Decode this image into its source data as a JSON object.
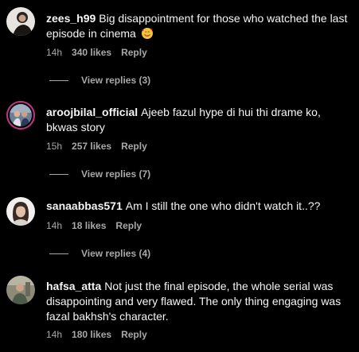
{
  "comments": [
    {
      "username": "zees_h99",
      "text": "Big disappointment for those who watched the last episode in cinema",
      "emoji": "smiling-face-with-hearts-icon",
      "time": "14h",
      "likes": "340 likes",
      "reply_label": "Reply",
      "view_replies": "View replies (3)"
    },
    {
      "username": "aroojbilal_official",
      "text": "Ajeeb fazul hype di hui thi drame ko, bkwas story",
      "time": "15h",
      "likes": "257 likes",
      "reply_label": "Reply",
      "view_replies": "View replies (7)"
    },
    {
      "username": "sanaabbas571",
      "text": "Am I still the one who didn't watch it..??",
      "time": "14h",
      "likes": "18 likes",
      "reply_label": "Reply",
      "view_replies": "View replies (4)"
    },
    {
      "username": "hafsa_atta",
      "text": "Not just the final episode, the whole serial was disappointing and very flawed. The only thing engaging was fazal bakhsh's character.",
      "time": "14h",
      "likes": "180 likes",
      "reply_label": "Reply"
    }
  ],
  "colors": {
    "background": "#000000",
    "text": "#f5f5f5",
    "secondary": "#a8a8a8",
    "story_ring": "#c13584"
  }
}
